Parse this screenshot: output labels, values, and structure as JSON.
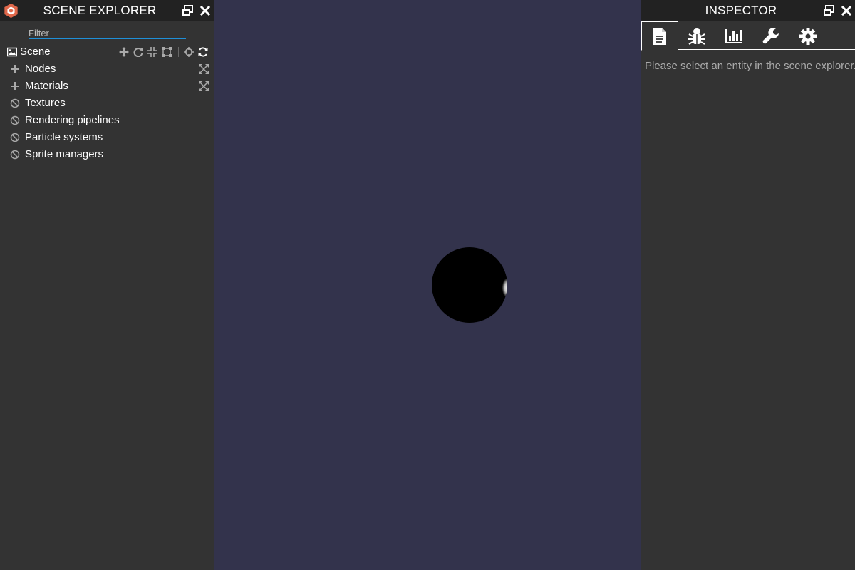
{
  "scene_explorer": {
    "title": "SCENE EXPLORER",
    "filter": {
      "placeholder": "Filter",
      "value": ""
    },
    "scene_label": "Scene",
    "items": [
      {
        "label": "Nodes",
        "icon": "plus-icon",
        "action_icon": "expand-icon"
      },
      {
        "label": "Materials",
        "icon": "plus-icon",
        "action_icon": "expand-icon"
      },
      {
        "label": "Textures",
        "icon": "ban-icon"
      },
      {
        "label": "Rendering pipelines",
        "icon": "ban-icon"
      },
      {
        "label": "Particle systems",
        "icon": "ban-icon"
      },
      {
        "label": "Sprite managers",
        "icon": "ban-icon"
      }
    ],
    "scene_tools": [
      "translate-gizmo-icon",
      "rotate-gizmo-icon",
      "scale-gizmo-icon",
      "bounding-box-gizmo-icon",
      "pick-icon",
      "refresh-icon"
    ]
  },
  "inspector": {
    "title": "INSPECTOR",
    "tabs": [
      "properties-tab",
      "debug-tab",
      "statistics-tab",
      "tools-tab",
      "settings-tab"
    ],
    "active_tab": "properties-tab",
    "empty_message": "Please select an entity in the scene explorer."
  },
  "colors": {
    "panel_bg": "#333333",
    "header_bg": "#222222",
    "canvas_bg": "#33334c",
    "filter_underline": "#1f8fd7",
    "logo": "#e0684b"
  }
}
